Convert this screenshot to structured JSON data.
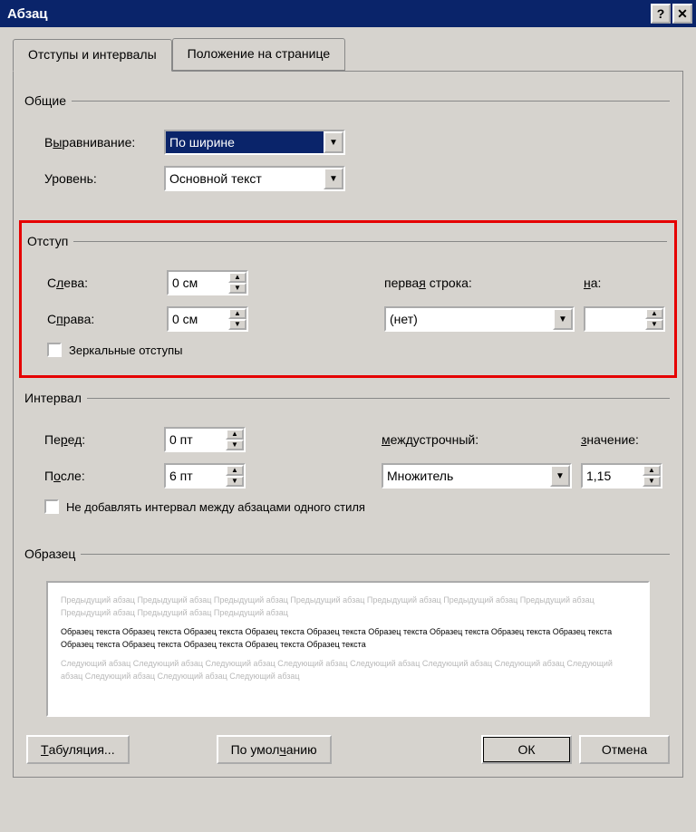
{
  "window": {
    "title": "Абзац"
  },
  "tabs": {
    "tab1": "Отступы и интервалы",
    "tab2": "Положение на странице"
  },
  "groups": {
    "general": "Общие",
    "indent": "Отступ",
    "interval": "Интервал",
    "sample": "Образец"
  },
  "general": {
    "align_label": "Выравнивание:",
    "align_value": "По ширине",
    "level_label": "Уровень:",
    "level_value": "Основной текст"
  },
  "indent": {
    "left_label": "Слева:",
    "left_value": "0 см",
    "right_label": "Справа:",
    "right_value": "0 см",
    "firstline_label": "первая строка:",
    "firstline_value": "(нет)",
    "by_label": "на:",
    "by_value": "",
    "mirror_label": "Зеркальные отступы"
  },
  "interval": {
    "before_label": "Перед:",
    "before_value": "0 пт",
    "after_label": "После:",
    "after_value": "6 пт",
    "linespacing_label": "междустрочный:",
    "linespacing_value": "Множитель",
    "at_label": "значение:",
    "at_value": "1,15",
    "noadd_label": "Не добавлять интервал между абзацами одного стиля"
  },
  "preview": {
    "prev_text": "Предыдущий абзац Предыдущий абзац Предыдущий абзац Предыдущий абзац Предыдущий абзац Предыдущий абзац Предыдущий абзац Предыдущий абзац Предыдущий абзац Предыдущий абзац",
    "sample_text": "Образец текста Образец текста Образец текста Образец текста Образец текста Образец текста Образец текста Образец текста Образец текста Образец текста Образец текста Образец текста Образец текста Образец текста",
    "next_text": "Следующий абзац Следующий абзац Следующий абзац Следующий абзац Следующий абзац Следующий абзац Следующий абзац Следующий абзац Следующий абзац Следующий абзац Следующий абзац"
  },
  "buttons": {
    "tabs": "Табуляция...",
    "default": "По умолчанию",
    "ok": "ОК",
    "cancel": "Отмена"
  }
}
